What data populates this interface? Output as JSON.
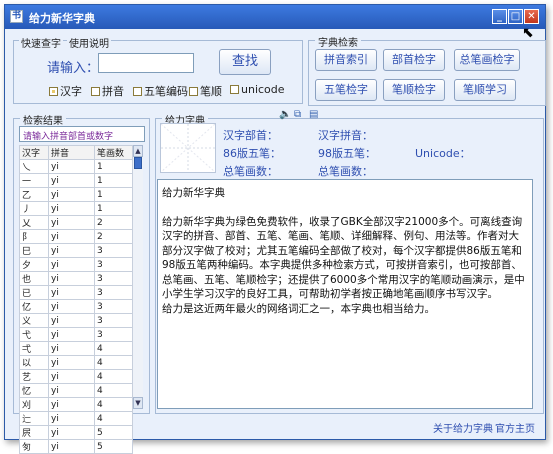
{
  "window": {
    "title": "给力新华字典",
    "app_icon": "书",
    "min_label": "_",
    "max_label": "□",
    "close_label": "✕"
  },
  "menu": {
    "quick_lookup": "快速查字",
    "help": "使用说明"
  },
  "search": {
    "label": "请输入：",
    "value": "",
    "button": "查找",
    "options": [
      {
        "label": "汉字",
        "checked": true
      },
      {
        "label": "拼音",
        "checked": false
      },
      {
        "label": "五笔编码",
        "checked": false
      },
      {
        "label": "笔顺",
        "checked": false
      },
      {
        "label": "unicode",
        "checked": false
      }
    ]
  },
  "dict_index": {
    "title": "字典检索",
    "buttons": [
      "拼音索引",
      "部首检字",
      "总笔画检字",
      "五笔检字",
      "笔顺检字",
      "笔顺学习"
    ]
  },
  "results": {
    "title": "检索结果",
    "placeholder": "请输入拼音部首或数字",
    "columns": [
      "汉字",
      "拼音",
      "笔画数"
    ],
    "rows": [
      [
        "乀",
        "yi",
        "1"
      ],
      [
        "一",
        "yi",
        "1"
      ],
      [
        "乙",
        "yi",
        "1"
      ],
      [
        "丿",
        "yi",
        "1"
      ],
      [
        "乂",
        "yi",
        "2"
      ],
      [
        "阝",
        "yi",
        "2"
      ],
      [
        "巳",
        "yi",
        "3"
      ],
      [
        "夕",
        "yi",
        "3"
      ],
      [
        "也",
        "yi",
        "3"
      ],
      [
        "已",
        "yi",
        "3"
      ],
      [
        "亿",
        "yi",
        "3"
      ],
      [
        "义",
        "yi",
        "3"
      ],
      [
        "弋",
        "yi",
        "3"
      ],
      [
        "弌",
        "yi",
        "4"
      ],
      [
        "以",
        "yi",
        "4"
      ],
      [
        "艺",
        "yi",
        "4"
      ],
      [
        "忆",
        "yi",
        "4"
      ],
      [
        "刈",
        "yi",
        "4"
      ],
      [
        "辷",
        "yi",
        "4"
      ],
      [
        "屄",
        "yi",
        "5"
      ],
      [
        "匇",
        "yi",
        "5"
      ]
    ]
  },
  "detail": {
    "title": "给力字典",
    "radical_label": "汉字部首：",
    "pinyin_label": "汉字拼音：",
    "wubi86_label": "86版五笔：",
    "wubi98_label": "98版五笔：",
    "unicode_label": "Unicode：",
    "strokes_label": "总笔画数：",
    "strokes_label2": "总笔画数："
  },
  "intro": {
    "heading": "给力新华字典",
    "paragraph1": "给力新华字典为绿色免费软件，收录了GBK全部汉字21000多个。可离线查询汉字的拼音、部首、五笔、笔画、笔顺、详细解释、例句、用法等。作者对大部分汉字做了校对；尤其五笔编码全部做了校对，每个汉字都提供86版五笔和98版五笔两种编码。本字典提供多种检索方式，可按拼音索引，也可按部首、总笔画、五笔、笔顺检字；还提供了6000多个常用汉字的笔顺动画演示，是中小学生学习汉字的良好工具，可帮助初学者按正确地笔画顺序书写汉字。",
    "paragraph2": "给力是这近两年最火的网络词汇之一，本字典也相当给力。"
  },
  "footer": {
    "about": "关于给力字典",
    "homepage": "官方主页"
  },
  "colors": {
    "accent": "#2f4fb0",
    "titlebar": "#2759b8",
    "background": "#e9f0fb"
  }
}
